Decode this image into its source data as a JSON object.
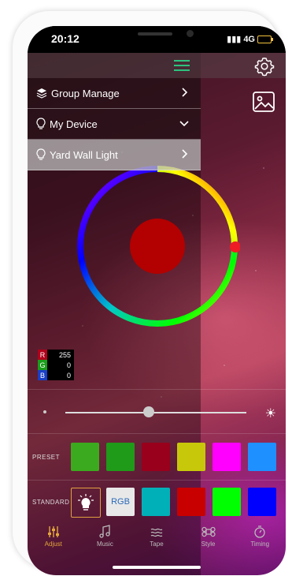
{
  "status": {
    "time": "20:12",
    "network": "4G"
  },
  "menu": {
    "items": [
      {
        "label": "Group Manage",
        "icon": "layers-icon",
        "chevron": "right"
      },
      {
        "label": "My Device",
        "icon": "bulb-icon",
        "chevron": "down"
      },
      {
        "label": "Yard Wall Light",
        "icon": "bulb-icon",
        "chevron": "right"
      }
    ]
  },
  "color": {
    "selected_hex": "#b30000",
    "r_label": "R",
    "g_label": "G",
    "b_label": "B",
    "r": "255",
    "g": "0",
    "b": "0"
  },
  "brightness": {
    "level": 0.46
  },
  "preset": {
    "label": "PRESET",
    "colors": [
      "#3caa1e",
      "#1f9a19",
      "#98001c",
      "#c8c80a",
      "#ff00ff",
      "#1e90ff"
    ]
  },
  "standard": {
    "label": "STANDARD",
    "rgb_label": "RGB",
    "colors": [
      "#00b0b8",
      "#c80000",
      "#00ff00",
      "#0000ff"
    ]
  },
  "tabs": [
    {
      "label": "Adjust",
      "icon": "sliders-icon",
      "active": true
    },
    {
      "label": "Music",
      "icon": "music-note-icon",
      "active": false
    },
    {
      "label": "Tape",
      "icon": "waves-icon",
      "active": false
    },
    {
      "label": "Style",
      "icon": "command-icon",
      "active": false
    },
    {
      "label": "Timing",
      "icon": "timer-icon",
      "active": false
    }
  ],
  "accent_color": "#e3a63c"
}
